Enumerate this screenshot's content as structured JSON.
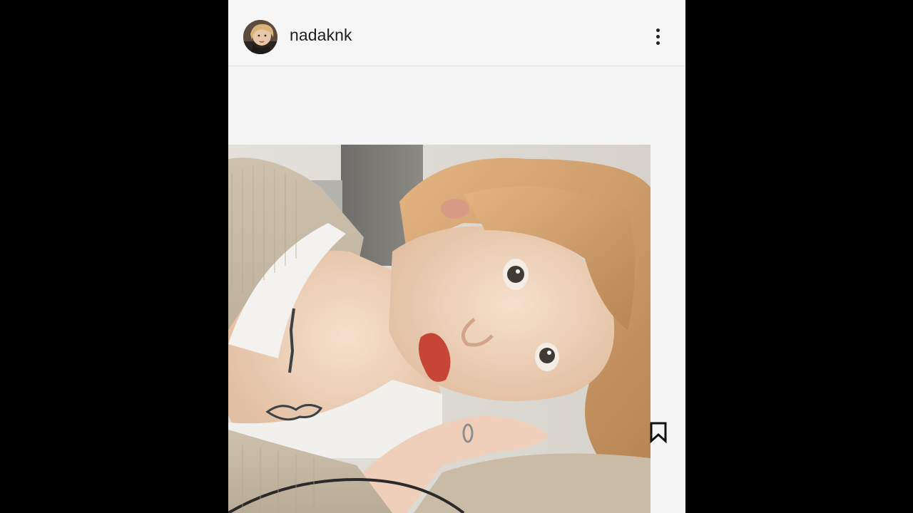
{
  "post": {
    "username": "nadaknk"
  },
  "icons": {
    "avatar": "profile-photo",
    "more": "more-vertical-icon",
    "save": "bookmark-icon",
    "photo": "selfie-image"
  },
  "colors": {
    "page_background": "#000000",
    "app_background": "#f5f5f5",
    "text": "#1e1e1e"
  }
}
